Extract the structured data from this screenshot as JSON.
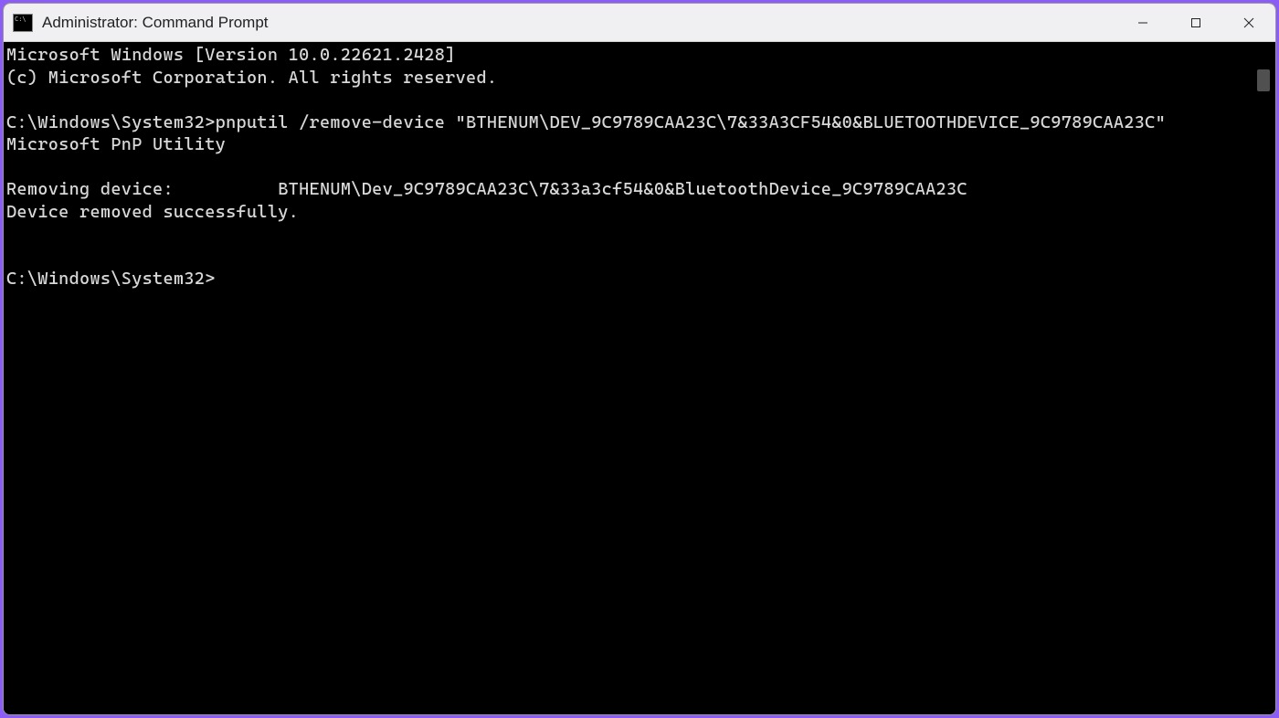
{
  "window": {
    "title": "Administrator: Command Prompt"
  },
  "terminal": {
    "lines": [
      "Microsoft Windows [Version 10.0.22621.2428]",
      "(c) Microsoft Corporation. All rights reserved.",
      "",
      "C:\\Windows\\System32>pnputil /remove-device \"BTHENUM\\DEV_9C9789CAA23C\\7&33A3CF54&0&BLUETOOTHDEVICE_9C9789CAA23C\"",
      "Microsoft PnP Utility",
      "",
      "Removing device:          BTHENUM\\Dev_9C9789CAA23C\\7&33a3cf54&0&BluetoothDevice_9C9789CAA23C",
      "Device removed successfully.",
      "",
      "",
      "C:\\Windows\\System32>"
    ]
  }
}
